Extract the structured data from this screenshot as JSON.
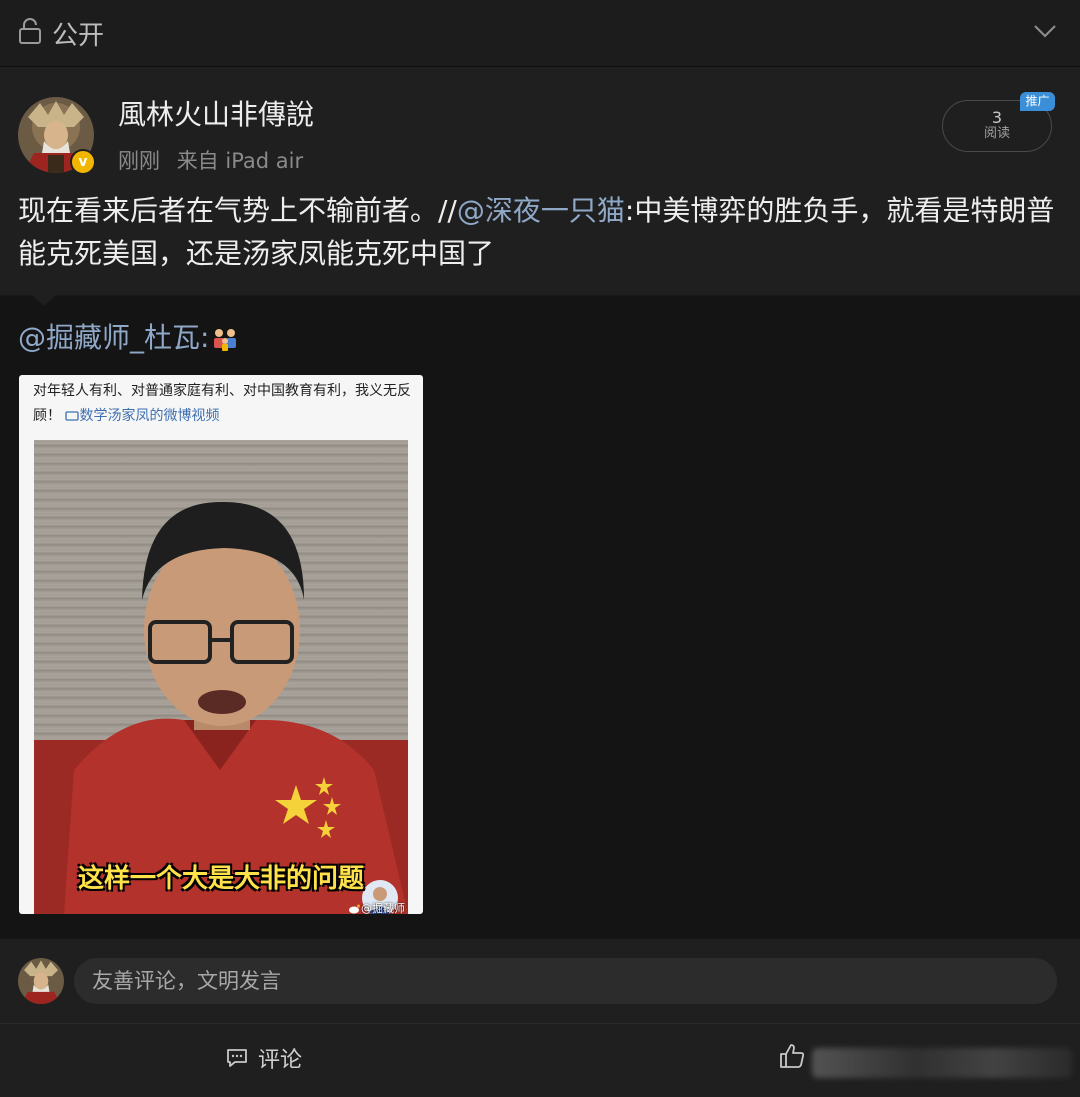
{
  "topbar": {
    "visibility_label": "公开"
  },
  "post": {
    "author": "風林火山非傳說",
    "time": "刚刚",
    "source": "来自 iPad air",
    "read_count": "3",
    "read_label": "阅读",
    "promo_badge": "推广",
    "text_before": "现在看来后者在气势上不输前者。//",
    "mention": "@深夜一只猫",
    "text_after": ":中美博弈的胜负手，就看是特朗普能克死美国，还是汤家凤能克死中国了"
  },
  "repost": {
    "author": "@掘藏师_杜瓦",
    "author_suffix": ":",
    "media": {
      "caption": "对年轻人有利、对普通家庭有利、对中国教育有利，我义无反顾！",
      "link_text": "数学汤家凤的微博视频",
      "subtitle": "这样一个大是大非的问题",
      "watermark": "@掘藏师_杜瓦"
    }
  },
  "comment": {
    "placeholder": "友善评论，文明发言"
  },
  "actions": {
    "comment_label": "评论"
  },
  "colors": {
    "mention": "#8fa8c8",
    "promo": "#3b8fd9",
    "verified": "#f2b600",
    "subtitle": "#ffe14a"
  },
  "icons": [
    "lock-icon",
    "chevron-down-icon",
    "verified-icon",
    "weibo-icon",
    "comment-icon",
    "like-icon"
  ]
}
